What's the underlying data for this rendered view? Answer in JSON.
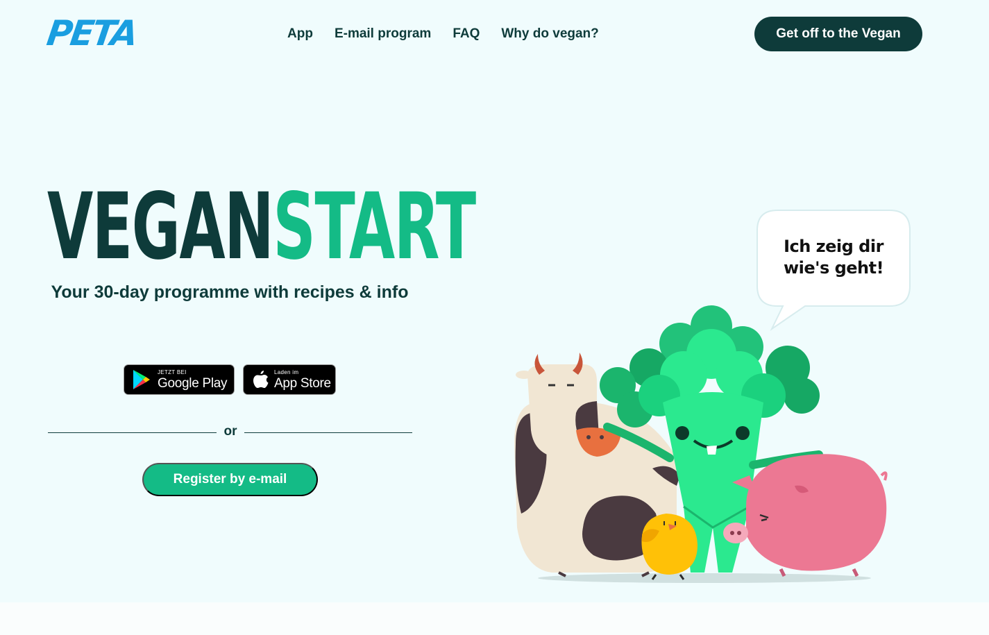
{
  "header": {
    "logo_text": "PETA",
    "nav": [
      "App",
      "E-mail program",
      "FAQ",
      "Why do vegan?"
    ],
    "cta_label": "Get off to the Vegan"
  },
  "hero": {
    "title_part1": "VEGAN",
    "title_part2": "START",
    "subtitle": "Your 30-day programme with recipes & info",
    "google_play": {
      "small": "JETZT BEI",
      "big": "Google Play"
    },
    "app_store": {
      "small": "Laden im",
      "big": "App Store"
    },
    "or_label": "or",
    "register_label": "Register by e-mail"
  },
  "speech_bubble": {
    "line1": "Ich zeig dir",
    "line2": "wie's geht!"
  },
  "colors": {
    "background": "#f0fcfd",
    "dark_green": "#0e3b3a",
    "accent_green": "#14bb86",
    "peta_blue": "#1a9ee0"
  },
  "icons": [
    "google-play-icon",
    "apple-icon"
  ]
}
